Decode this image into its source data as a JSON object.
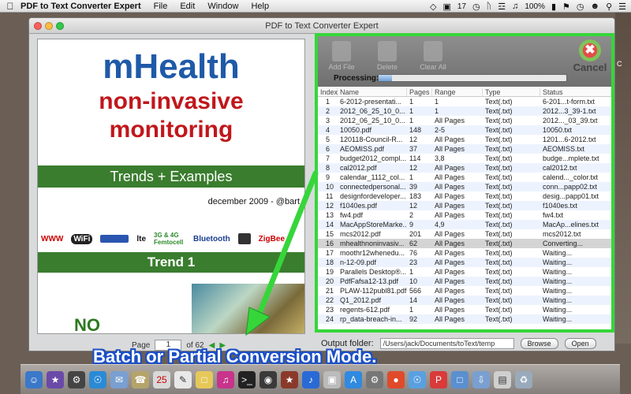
{
  "menubar": {
    "app_name": "PDF to Text Converter Expert",
    "menus": [
      "File",
      "Edit",
      "Window",
      "Help"
    ],
    "battery": "100%",
    "brightness": "17"
  },
  "window": {
    "title": "PDF to Text Converter Expert"
  },
  "preview": {
    "title": "mHealth",
    "subtitle_line1": "non-invasive",
    "subtitle_line2": "monitoring",
    "banner1": "Trends + Examples",
    "date_line": "december 2009 - @bart",
    "logos": [
      "WWW",
      "WiFi",
      "lte",
      "3G & 4G Femtocell",
      "Bluetooth",
      "ZigBee"
    ],
    "banner2": "Trend 1",
    "no_text": "NO",
    "page_label": "Page",
    "page_value": "1",
    "page_of": "of 62"
  },
  "toolbar": {
    "add_file": "Add File",
    "delete": "Delete",
    "clear_all": "Clear All",
    "cancel": "Cancel",
    "processing_label": "Processing:",
    "progress": 0.07
  },
  "table": {
    "headers": [
      "Index",
      "Name",
      "Pages",
      "Range",
      "Type",
      "Status"
    ],
    "rows": [
      [
        "1",
        "6-2012-presentati...",
        "1",
        "1",
        "Text(.txt)",
        "6-201...t-form.txt"
      ],
      [
        "2",
        "2012_06_25_10_0...",
        "1",
        "1",
        "Text(.txt)",
        "2012...3_39-1.txt"
      ],
      [
        "3",
        "2012_06_25_10_0...",
        "1",
        "All Pages",
        "Text(.txt)",
        "2012..._03_39.txt"
      ],
      [
        "4",
        "10050.pdf",
        "148",
        "2-5",
        "Text(.txt)",
        "10050.txt"
      ],
      [
        "5",
        "120118-Council-R...",
        "12",
        "All Pages",
        "Text(.txt)",
        "1201...6-2012.txt"
      ],
      [
        "6",
        "AEOMISS.pdf",
        "37",
        "All Pages",
        "Text(.txt)",
        "AEOMISS.txt"
      ],
      [
        "7",
        "budget2012_compl...",
        "114",
        "3,8",
        "Text(.txt)",
        "budge...mplete.txt"
      ],
      [
        "8",
        "cal2012.pdf",
        "12",
        "All Pages",
        "Text(.txt)",
        "cal2012.txt"
      ],
      [
        "9",
        "calendar_1112_col...",
        "1",
        "All Pages",
        "Text(.txt)",
        "calend..._color.txt"
      ],
      [
        "10",
        "connectedpersonal...",
        "39",
        "All Pages",
        "Text(.txt)",
        "conn...papp02.txt"
      ],
      [
        "11",
        "designfordeveloper...",
        "183",
        "All Pages",
        "Text(.txt)",
        "desig...papp01.txt"
      ],
      [
        "12",
        "f1040es.pdf",
        "12",
        "All Pages",
        "Text(.txt)",
        "f1040es.txt"
      ],
      [
        "13",
        "fw4.pdf",
        "2",
        "All Pages",
        "Text(.txt)",
        "fw4.txt"
      ],
      [
        "14",
        "MacAppStoreMarke...",
        "9",
        "4,9",
        "Text(.txt)",
        "MacAp...elines.txt"
      ],
      [
        "15",
        "mcs2012.pdf",
        "201",
        "All Pages",
        "Text(.txt)",
        "mcs2012.txt"
      ],
      [
        "16",
        "mhealthnoninvasiv...",
        "62",
        "All Pages",
        "Text(.txt)",
        "Converting..."
      ],
      [
        "17",
        "moothr12whenedu...",
        "76",
        "All Pages",
        "Text(.txt)",
        "Waiting..."
      ],
      [
        "18",
        "n-12-09.pdf",
        "23",
        "All Pages",
        "Text(.txt)",
        "Waiting..."
      ],
      [
        "19",
        "Parallels Desktop®...",
        "1",
        "All Pages",
        "Text(.txt)",
        "Waiting..."
      ],
      [
        "20",
        "PdfFafsa12-13.pdf",
        "10",
        "All Pages",
        "Text(.txt)",
        "Waiting..."
      ],
      [
        "21",
        "PLAW-112publ81.pdf",
        "566",
        "All Pages",
        "Text(.txt)",
        "Waiting..."
      ],
      [
        "22",
        "Q1_2012.pdf",
        "14",
        "All Pages",
        "Text(.txt)",
        "Waiting..."
      ],
      [
        "23",
        "regents-612.pdf",
        "1",
        "All Pages",
        "Text(.txt)",
        "Waiting..."
      ],
      [
        "24",
        "rp_data-breach-in...",
        "92",
        "All Pages",
        "Text(.txt)",
        "Waiting..."
      ]
    ]
  },
  "output": {
    "label": "Output folder:",
    "path": "/Users/jack/Documents/toText/temp",
    "browse": "Browse",
    "open": "Open"
  },
  "caption": "Batch or Partial Conversion Mode.",
  "colors": {
    "highlight_green": "#36d63a",
    "caption_blue": "#1a4fc7"
  }
}
